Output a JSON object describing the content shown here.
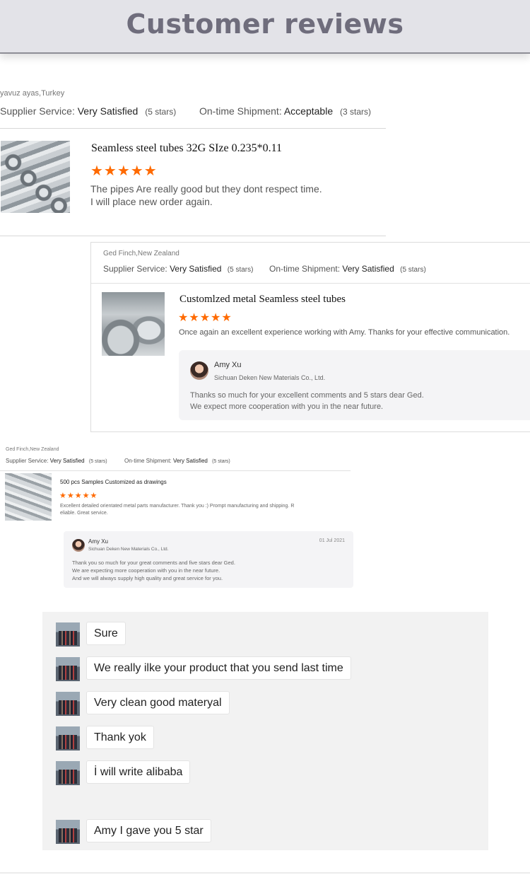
{
  "header": {
    "title": "Customer reviews"
  },
  "reviews": [
    {
      "reviewer": "yavuz ayas,Turkey",
      "supplier_label": "Supplier Service:",
      "supplier_value": "Very Satisfied",
      "supplier_stars": "(5 stars)",
      "shipment_label": "On-time Shipment:",
      "shipment_value": "Acceptable",
      "shipment_stars": "(3 stars)",
      "product": "Seamless steel tubes 32G SIze 0.235*0.11",
      "rating": 5,
      "comment_line1": "The pipes Are really good but they dont respect time.",
      "comment_line2": "I will place new order again."
    },
    {
      "reviewer": "Ged Finch,New Zealand",
      "supplier_label": "Supplier Service:",
      "supplier_value": "Very Satisfied",
      "supplier_stars": "(5 stars)",
      "shipment_label": "On-time Shipment:",
      "shipment_value": "Very Satisfied",
      "shipment_stars": "(5 stars)",
      "product": "Customlzed metal Seamless steel tubes",
      "rating": 5,
      "comment": "Once again an excellent experience working with Amy. Thanks for your effective communication.",
      "reply": {
        "name": "Amy Xu",
        "company": "Sichuan Deken New Materials Co., Ltd.",
        "line1": "Thanks so much for your excellent comments and 5 stars dear Ged.",
        "line2": "We expect more cooperation with you in the near future."
      }
    },
    {
      "reviewer": "Ged Finch,New Zealand",
      "supplier_label": "Supplier Service:",
      "supplier_value": "Very Satisfied",
      "supplier_stars": "(5 stars)",
      "shipment_label": "On-time Shipment:",
      "shipment_value": "Very Satisfied",
      "shipment_stars": "(5 stars)",
      "product": "500 pcs Samples Customized as drawings",
      "rating": 5,
      "comment_line1": "Excellent detailed orientated metal parts manufacturer. Thank you :) Prompt manufacturing and shipping. R",
      "comment_line2": "eliable. Great service.",
      "reply": {
        "name": "Amy Xu",
        "company": "Sichuan Deken New Materials Co., Ltd.",
        "date": "01 Jul 2021",
        "line1": "Thank you so much for your great comments and five stars dear Ged.",
        "line2": "We are expecting more cooperation with you in the near future.",
        "line3": "And we will always supply high quality and great service for you."
      }
    }
  ],
  "stars_text": "★★★★★",
  "chat": {
    "messages": [
      "Sure",
      "We really ilke your product that you send last time",
      "Very clean good materyal",
      "Thank yok",
      "İ will write alibaba",
      "Amy I gave you 5 star"
    ]
  },
  "colors": {
    "star": "#ff6a00",
    "header_bg": "#e3e3e8",
    "header_text": "#6f6d7c",
    "chat_bg": "#f2f2f2"
  }
}
